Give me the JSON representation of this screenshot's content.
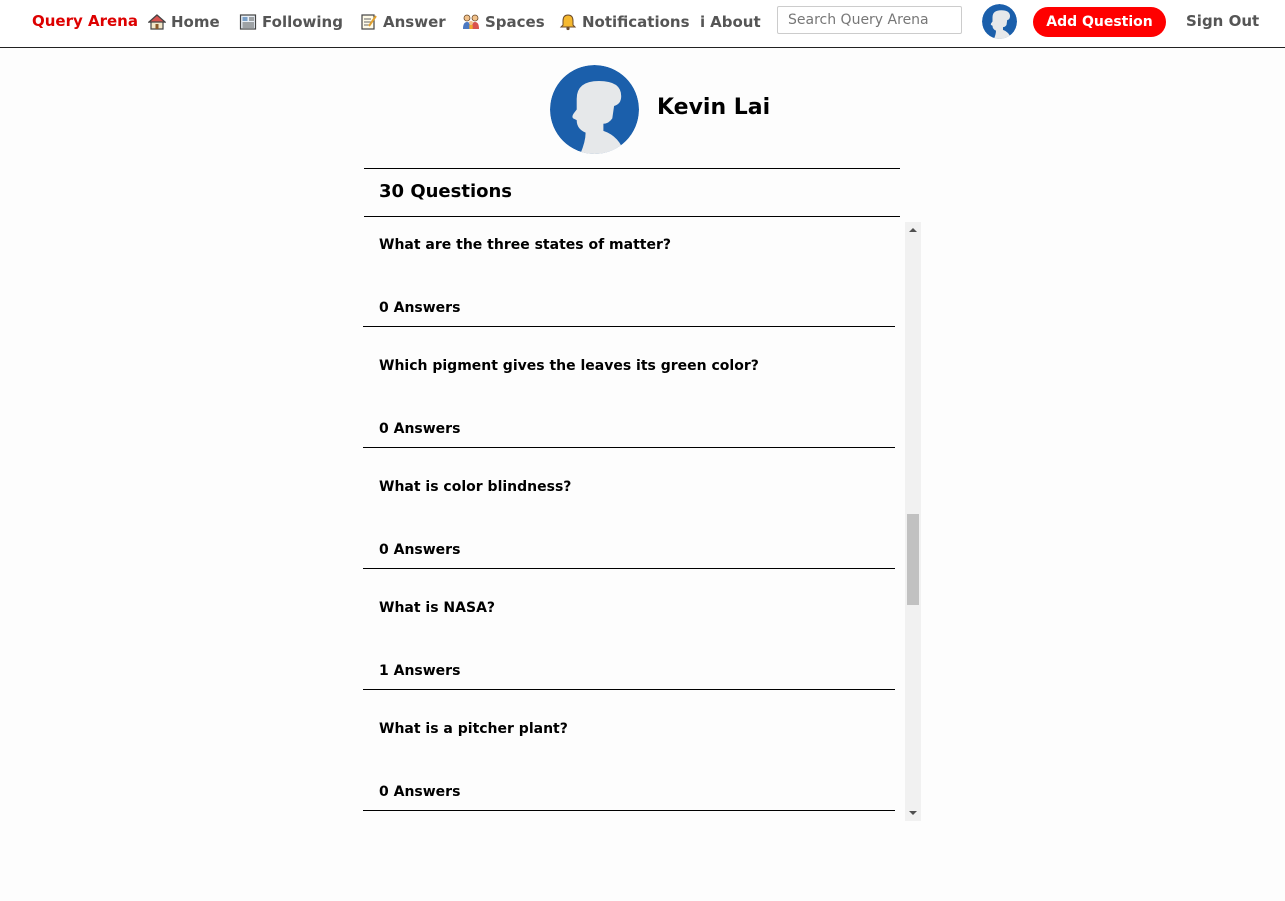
{
  "navbar": {
    "brand": "Query Arena",
    "items": [
      {
        "label": "Home",
        "icon": "house-icon"
      },
      {
        "label": "Following",
        "icon": "newspaper-icon"
      },
      {
        "label": "Answer",
        "icon": "memo-icon"
      },
      {
        "label": "Spaces",
        "icon": "family-icon"
      },
      {
        "label": "Notifications",
        "icon": "bell-icon"
      },
      {
        "label": "About",
        "icon": "info-icon"
      }
    ],
    "info_glyph": "i",
    "search_placeholder": "Search Query Arena",
    "add_question_label": "Add Question",
    "sign_out_label": "Sign Out"
  },
  "profile": {
    "name": "Kevin Lai",
    "question_count_label": "30 Questions"
  },
  "questions": [
    {
      "title": "What are the three states of matter?",
      "answers": "0 Answers"
    },
    {
      "title": "Which pigment gives the leaves its green color?",
      "answers": "0 Answers"
    },
    {
      "title": "What is color blindness?",
      "answers": "0 Answers"
    },
    {
      "title": "What is NASA?",
      "answers": "1 Answers"
    },
    {
      "title": "What is a pitcher plant?",
      "answers": "0 Answers"
    }
  ],
  "scroll": {
    "position_fraction": 0.58,
    "visible_fraction": 0.16
  },
  "colors": {
    "brand": "#dd0000",
    "add_button": "#ff0000",
    "avatar_blue": "#1b5fab",
    "avatar_silhouette": "#e6e8ea"
  }
}
